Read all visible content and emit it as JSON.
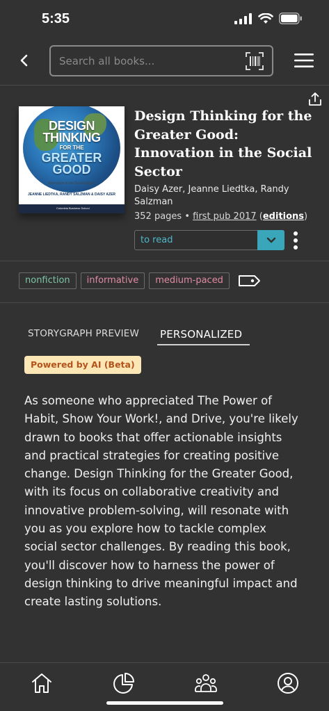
{
  "status_bar": {
    "time": "5:35"
  },
  "search": {
    "placeholder": "Search all books..."
  },
  "book": {
    "title": "Design Thinking for the Greater Good: Innovation in the Social Sector",
    "authors": "Daisy Azer, Jeanne Liedtka, Randy Salzman",
    "pages": "352 pages",
    "bullet": "•",
    "first_pub": "first pub 2017",
    "editions_open": "(",
    "editions": "editions",
    "editions_close": ")",
    "read_status": "to read"
  },
  "cover": {
    "title_line1": "DESIGN",
    "title_line2": "THINKING",
    "title_line3": "FOR THE",
    "title_line4": "GREATER",
    "title_line5": "GOOD",
    "subtitle": "Innovation in the Social Sector",
    "authors": "JEANNE LIEDTKA, RANDY SALZMAN & DAISY AZER",
    "publisher": "Columbia Business School"
  },
  "tags": [
    {
      "label": "nonfiction",
      "color": "#7cc4a4"
    },
    {
      "label": "informative",
      "color": "#e08aa4"
    },
    {
      "label": "medium-paced",
      "color": "#e08aa4"
    }
  ],
  "tabs": {
    "preview": "STORYGRAPH PREVIEW",
    "personalized": "PERSONALIZED"
  },
  "ai_badge": "Powered by AI (Beta)",
  "summary": "As someone who appreciated The Power of Habit, Show Your Work!, and Drive, you're likely drawn to books that offer actionable insights and practical strategies for creating positive change. Design Thinking for the Greater Good, with its focus on collaborative creativity and innovative problem-solving, will resonate with you as you explore how to tackle complex social sector challenges. By reading this book, you'll discover how to harness the power of design thinking to drive meaningful impact and create lasting solutions.",
  "bottom_nav": [
    "home-icon",
    "stats-icon",
    "community-icon",
    "profile-icon"
  ],
  "colors": {
    "background": "#323232",
    "accent": "#3aa6b9",
    "badge_bg": "#fbe7b6",
    "badge_text": "#b5531c"
  }
}
